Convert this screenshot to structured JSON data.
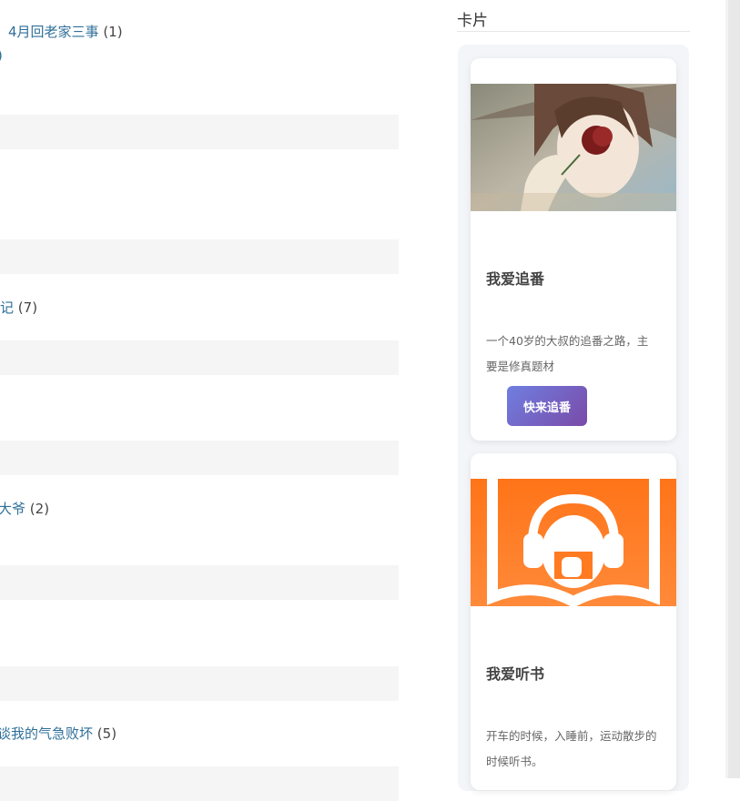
{
  "posts": [
    {
      "link": "4月回老家三事",
      "count": "(1)"
    },
    {
      "link": ")",
      "count": ""
    },
    {
      "link": "记",
      "count": "(7)"
    },
    {
      "link": "大爷",
      "count": "(2)"
    },
    {
      "link": "谈我的气急败坏",
      "count": "(5)"
    }
  ],
  "sidebar": {
    "title": "卡片",
    "cards": [
      {
        "title": "我爱追番",
        "desc": "一个40岁的大叔的追番之路，主要是修真题材",
        "button": "快来追番"
      },
      {
        "title": "我爱听书",
        "desc": "开车的时候，入睡前，运动散步的时候听书。"
      }
    ]
  },
  "colors": {
    "link": "#2f6f99",
    "stripe": "#f5f5f5",
    "button_from": "#6f7fe0",
    "button_to": "#7a4aa8",
    "book_orange": "#ff7f22"
  }
}
